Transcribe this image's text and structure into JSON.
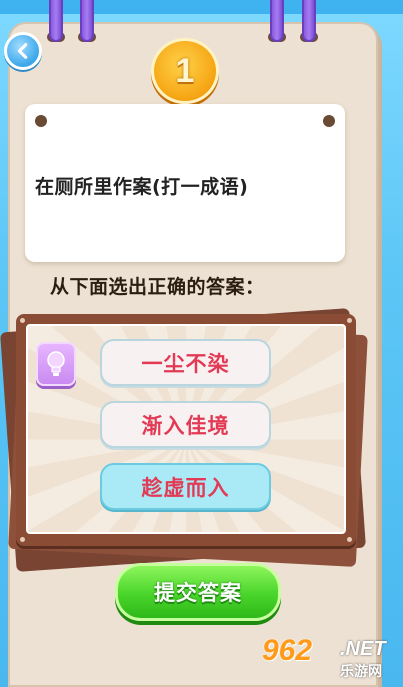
{
  "level": {
    "number": "1"
  },
  "question": {
    "text": "在厕所里作案(打一成语)"
  },
  "instruction": "从下面选出正确的答案：",
  "options": [
    {
      "label": "一尘不染",
      "state": "normal"
    },
    {
      "label": "渐入佳境",
      "state": "normal"
    },
    {
      "label": "趁虚而入",
      "state": "selected"
    }
  ],
  "submit": {
    "label": "提交答案"
  },
  "watermark": {
    "number": "962",
    "suffix": ".NET",
    "site": "乐游网"
  },
  "icons": {
    "back": "back-arrow-icon",
    "hint": "lightbulb-icon"
  },
  "colors": {
    "accent_green": "#49d52a",
    "option_text": "#e23a55",
    "selected_bg": "#a9eaf6",
    "frame": "#8b4c36",
    "badge": "#f6a716"
  }
}
